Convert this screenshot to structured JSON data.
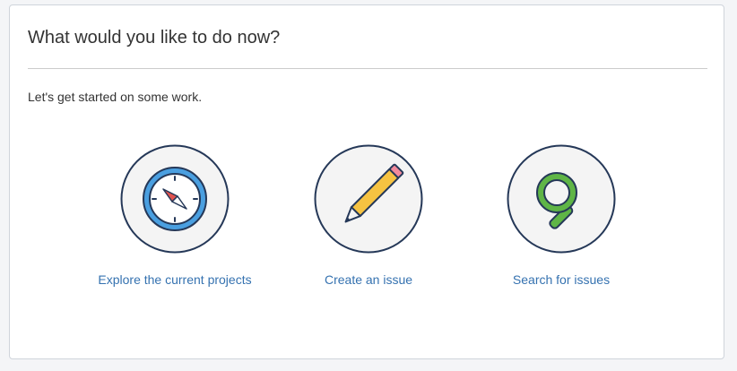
{
  "dialog": {
    "title": "What would you like to do now?",
    "intro": "Let's get started on some work."
  },
  "actions": [
    {
      "label": "Explore the current projects",
      "icon": "compass-icon"
    },
    {
      "label": "Create an issue",
      "icon": "pencil-icon"
    },
    {
      "label": "Search for issues",
      "icon": "magnifier-icon"
    }
  ],
  "colors": {
    "link": "#3572b0",
    "circle_border": "#253858",
    "circle_fill": "#f4f4f4",
    "compass_blue": "#4a9fe0",
    "pencil_yellow": "#f6c342",
    "eraser_pink": "#f28a9b",
    "magnifier_green": "#5fb546",
    "needle_red": "#e0534f"
  }
}
